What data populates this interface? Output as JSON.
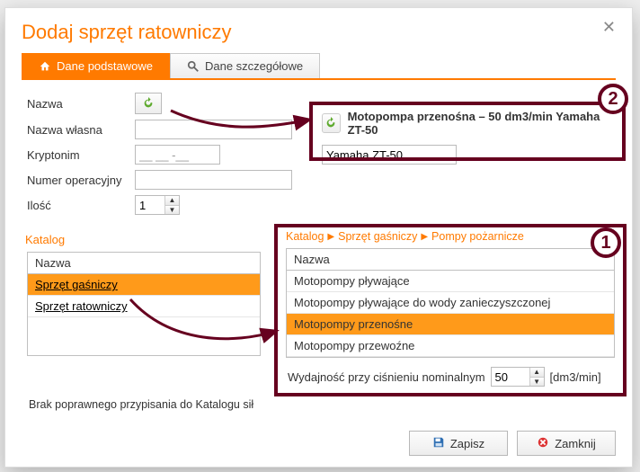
{
  "dialog": {
    "title": "Dodaj sprzęt ratowniczy"
  },
  "tabs": {
    "basic": "Dane podstawowe",
    "details": "Dane szczegółowe"
  },
  "form": {
    "name_label": "Nazwa",
    "own_name_label": "Nazwa własna",
    "codename_label": "Kryptonim",
    "codename_value": "__ __ -__",
    "opnum_label": "Numer operacyjny",
    "qty_label": "Ilość",
    "qty_value": "1"
  },
  "catalog": {
    "heading": "Katalog",
    "col": "Nazwa",
    "rows": [
      "Sprzęt gaśniczy",
      "Sprzęt ratowniczy"
    ],
    "note": "Brak poprawnego przypisania do Katalogu sił"
  },
  "popup2": {
    "title": "Motopompa przenośna – 50 dm3/min Yamaha ZT-50",
    "name_value": "Yamaha ZT-50"
  },
  "popup1": {
    "crumb1": "Katalog",
    "crumb2": "Sprzęt gaśniczy",
    "crumb3": "Pompy pożarnicze",
    "col": "Nazwa",
    "rows": [
      "Motopompy pływające",
      "Motopompy pływające do wody zanieczyszczonej",
      "Motopompy przenośne",
      "Motopompy przewoźne"
    ],
    "perf_label": "Wydajność przy ciśnieniu nominalnym",
    "perf_value": "50",
    "perf_unit": "[dm3/min]"
  },
  "badges": {
    "one": "1",
    "two": "2"
  },
  "footer": {
    "save": "Zapisz",
    "close": "Zamknij"
  }
}
